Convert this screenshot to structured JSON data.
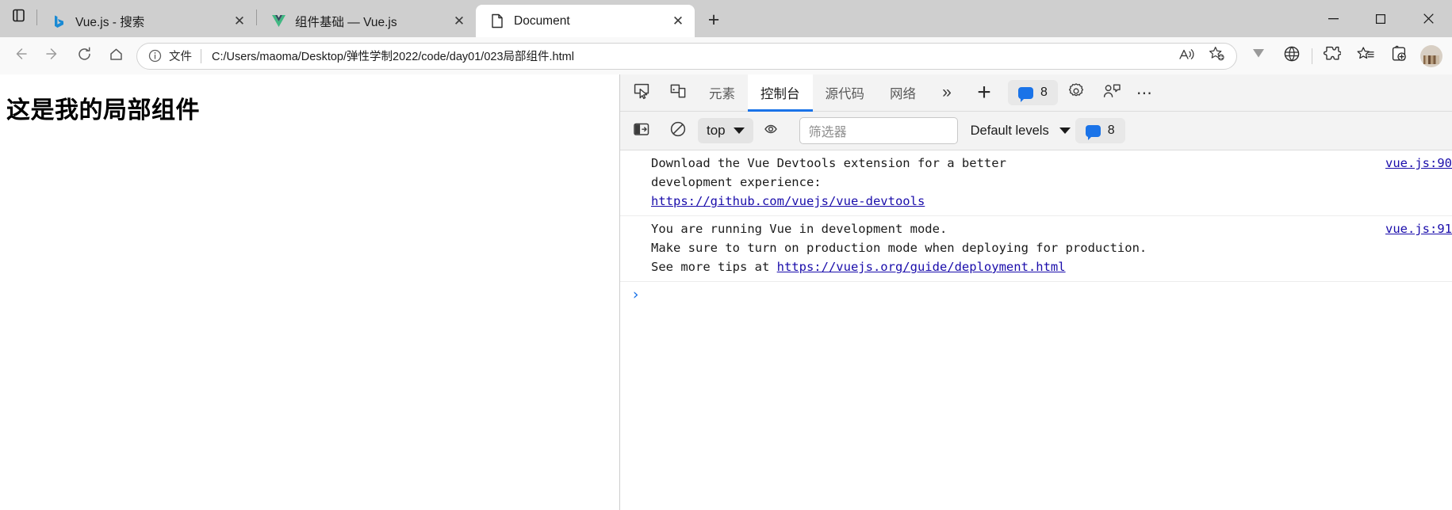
{
  "window": {
    "minimize_label": "—",
    "maximize_label": "□",
    "close_label": "✕"
  },
  "tabs": {
    "items": [
      {
        "title": "Vue.js - 搜索",
        "favicon": "bing-icon",
        "close_label": "✕",
        "active": false
      },
      {
        "title": "组件基础 — Vue.js",
        "favicon": "vue-icon",
        "close_label": "✕",
        "active": false
      },
      {
        "title": "Document",
        "favicon": "document-icon",
        "close_label": "✕",
        "active": true
      }
    ],
    "new_tab_label": "+",
    "tab_list_icon": "tab-list-icon"
  },
  "address_bar": {
    "back_icon": "back-arrow-icon",
    "forward_icon": "forward-arrow-icon",
    "reload_icon": "reload-icon",
    "home_icon": "home-icon",
    "info_icon": "info-circle-icon",
    "scheme_label": "文件",
    "url": "C:/Users/maoma/Desktop/弹性学制2022/code/day01/023局部组件.html",
    "read_aloud_icon": "read-aloud-icon",
    "add_favorite_icon": "add-favorite-star-icon",
    "downloads_icon": "downloads-chevron-icon",
    "extensions_icon": "extensions-puzzle-icon",
    "favorites_icon": "favorites-star-list-icon",
    "collections_icon": "collections-icon",
    "profile_icon": "profile-avatar-icon"
  },
  "page": {
    "heading": "这是我的局部组件"
  },
  "devtools": {
    "inspect_icon": "inspect-element-icon",
    "device_toolbar_icon": "device-toolbar-icon",
    "tabs": [
      {
        "label": "元素",
        "active": false
      },
      {
        "label": "控制台",
        "active": true
      },
      {
        "label": "源代码",
        "active": false
      },
      {
        "label": "网络",
        "active": false
      }
    ],
    "more_tabs_label": "»",
    "add_panel_label": "+",
    "message_badge": {
      "icon": "message-bubble-icon",
      "count": "8"
    },
    "settings_icon": "gear-icon",
    "feedback_icon": "feedback-icon",
    "more_options_label": "⋯",
    "console_toolbar": {
      "clear_icon": "clear-console-icon",
      "no_entry_icon": "no-entry-icon",
      "context_label": "top",
      "eye_icon": "live-expression-eye-icon",
      "filter_placeholder": "筛选器",
      "levels_label": "Default levels",
      "issues_icon": "message-bubble-icon",
      "issues_count": "8"
    },
    "console_messages": [
      {
        "id": "vue-devtools-msg",
        "lines": [
          {
            "text": "Download the Vue Devtools extension for a better"
          },
          {
            "text": "development experience:"
          },
          {
            "text": "https://github.com/vuejs/vue-devtools",
            "link": true
          }
        ],
        "source": "vue.js:90"
      },
      {
        "id": "vue-dev-mode-msg",
        "lines": [
          {
            "text": "You are running Vue in development mode."
          },
          {
            "text": "Make sure to turn on production mode when deploying for production."
          },
          {
            "text": "See more tips at ",
            "suffix_link": "https://vuejs.org/guide/deployment.html"
          }
        ],
        "source": "vue.js:91"
      }
    ],
    "prompt_caret": "›"
  },
  "colors": {
    "accent": "#1a73e8",
    "link": "#1a0dab",
    "chrome_bg": "#cfcfcf",
    "toolbar_bg": "#f9f9f9",
    "devtools_bg": "#f3f3f3"
  }
}
